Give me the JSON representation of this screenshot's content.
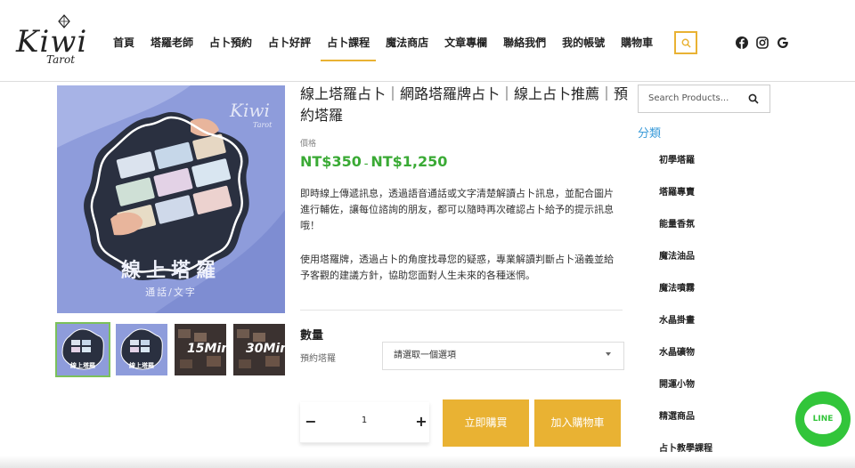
{
  "brand": {
    "name": "Kiwi",
    "sub": "Tarot"
  },
  "nav": {
    "items": [
      "首頁",
      "塔羅老師",
      "占卜預約",
      "占卜好評",
      "占卜課程",
      "魔法商店",
      "文章專欄",
      "聯絡我們",
      "我的帳號",
      "購物車"
    ],
    "active_index": 4
  },
  "social_icons": [
    "facebook-icon",
    "instagram-icon",
    "google-icon"
  ],
  "product": {
    "image_title": "線上塔羅",
    "image_subtitle": "通話/文字",
    "image_brand": "Kiwi",
    "image_brand_sub": "Tarot",
    "thumbs": [
      {
        "label": "線上塔羅",
        "icon": "tarot-thumb-1"
      },
      {
        "label": "線上塔羅",
        "icon": "tarot-thumb-2"
      },
      {
        "label": "15Min",
        "icon": "tarot-thumb-15"
      },
      {
        "label": "30Min",
        "icon": "tarot-thumb-30"
      }
    ],
    "title": "線上塔羅占卜｜網路塔羅牌占卜｜線上占卜推薦｜預約塔羅",
    "price_label": "價格",
    "price_low": "NT$350",
    "price_sep": "–",
    "price_high": "NT$1,250",
    "desc1": "即時線上傳遞訊息，透過語音通話或文字清楚解讀占卜訊息，並配合圖片進行輔佐，讓每位諮詢的朋友，都可以隨時再次確認占卜給予的提示訊息哦！",
    "desc2": "使用塔羅牌，透過占卜的角度找尋您的疑惑，專業解讀判斷占卜涵義並給予客觀的建議方針，協助您面對人生未來的各種迷惘。",
    "qty_title": "數量",
    "option_label": "預約塔羅",
    "option_placeholder": "請選取一個選項",
    "qty_value": "1",
    "minus": "−",
    "plus": "+",
    "buy_now": "立即購買",
    "add_cart": "加入購物車"
  },
  "sidebar": {
    "search_placeholder": "Search Products...",
    "categories_title": "分類",
    "categories": [
      "初學塔羅",
      "塔羅專賣",
      "能量香氛",
      "魔法油品",
      "魔法噴霧",
      "水晶掛畫",
      "水晶礦物",
      "開運小物",
      "精選商品",
      "占卜教學課程"
    ]
  },
  "line_button": {
    "label": "LINE"
  },
  "colors": {
    "accent": "#e9b233",
    "price": "#3aaa35",
    "category": "#3a9bd9",
    "line": "#32c53a",
    "product_bg": "#8e9cdb"
  }
}
